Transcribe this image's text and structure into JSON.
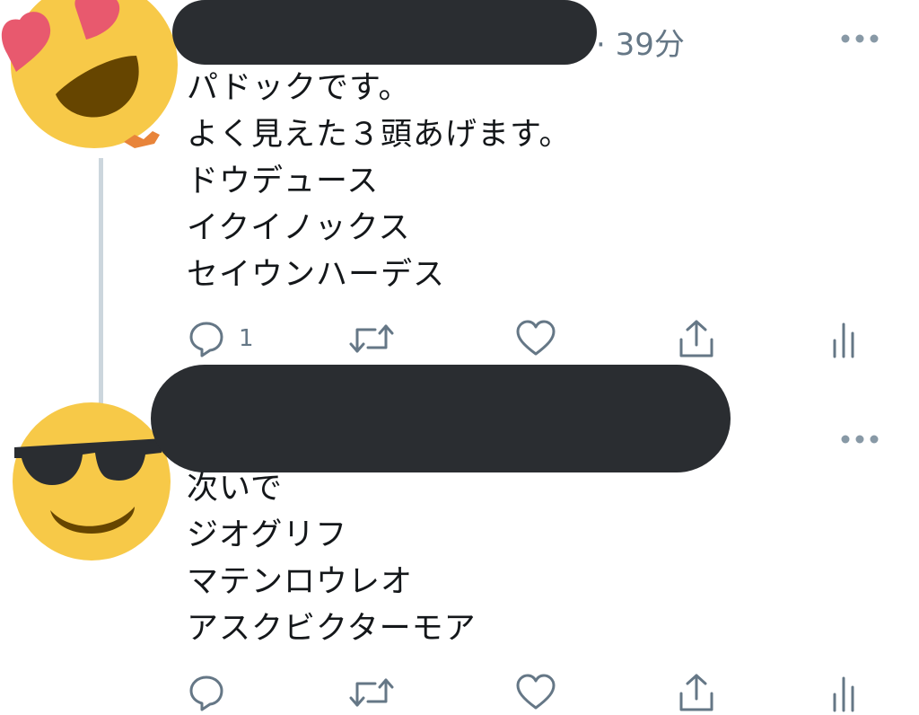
{
  "tweets": [
    {
      "time": "· 39分",
      "lines": [
        "パドックです。",
        "よく見えた３頭あげます。",
        "ドウデュース",
        "イクイノックス",
        "セイウンハーデス"
      ],
      "actions": {
        "reply_count": "1"
      },
      "avatar_icon": "heart-eyes-emoji-icon"
    },
    {
      "lines": [
        "次いで",
        "ジオグリフ",
        "マテンロウレオ",
        "アスクビクターモア"
      ],
      "avatar_icon": "sunglasses-emoji-icon"
    }
  ],
  "colors": {
    "text": "#14171a",
    "muted": "#657786",
    "redaction": "#2a2d31",
    "thread_line": "#ccd6dd"
  }
}
